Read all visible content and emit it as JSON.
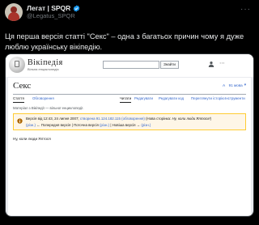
{
  "tweet": {
    "display_name": "Легат | SPQR",
    "handle": "@Legatus_SPQR",
    "more_icon": "more-dots-icon",
    "text": "Ця перша версія статті \"Секс\" – одна з багатьох причин чому я дуже люблю українську вікіпедію."
  },
  "wiki": {
    "logo_title": "Вікіпедія",
    "logo_subtitle": "Вільна енциклопедія",
    "search_button": "Знайти",
    "article_title": "Секс",
    "lang_button": "91 мова",
    "tabs": {
      "article": "Стаття",
      "discussion": "Обговорення",
      "read": "Читати",
      "edit": "Редагувати",
      "edit_code": "Редагувати код",
      "history": "Переглянути історію",
      "tools": "Інструменти"
    },
    "from_wiki": "Матеріал з Вікіпедії — вільної енциклопедії.",
    "revision": {
      "prefix": "Версія від 12:43, 24 липня 2007; ",
      "editor": "створена 91.124.182.115",
      "discussion": "(обговорення)",
      "summary_label": " (Нова сторінка: ",
      "summary": "Ну, коли люди Ялтося!",
      "summary_end": ")",
      "diff": "(різн.)",
      "prev": "← Попередня версія",
      "current": "Поточна версія",
      "current_diff": "(різн.)",
      "next": "Новіша версія →",
      "next_diff": "(різн.)"
    },
    "content": "Ну, коли люди Ялтося"
  },
  "colors": {
    "background": "#000000",
    "text": "#e7e9ea",
    "muted": "#71767b",
    "verified": "#1d9bf0",
    "wiki_link": "#3366cc",
    "revision_bg": "#fef6e7",
    "revision_border": "#ffcc33"
  }
}
